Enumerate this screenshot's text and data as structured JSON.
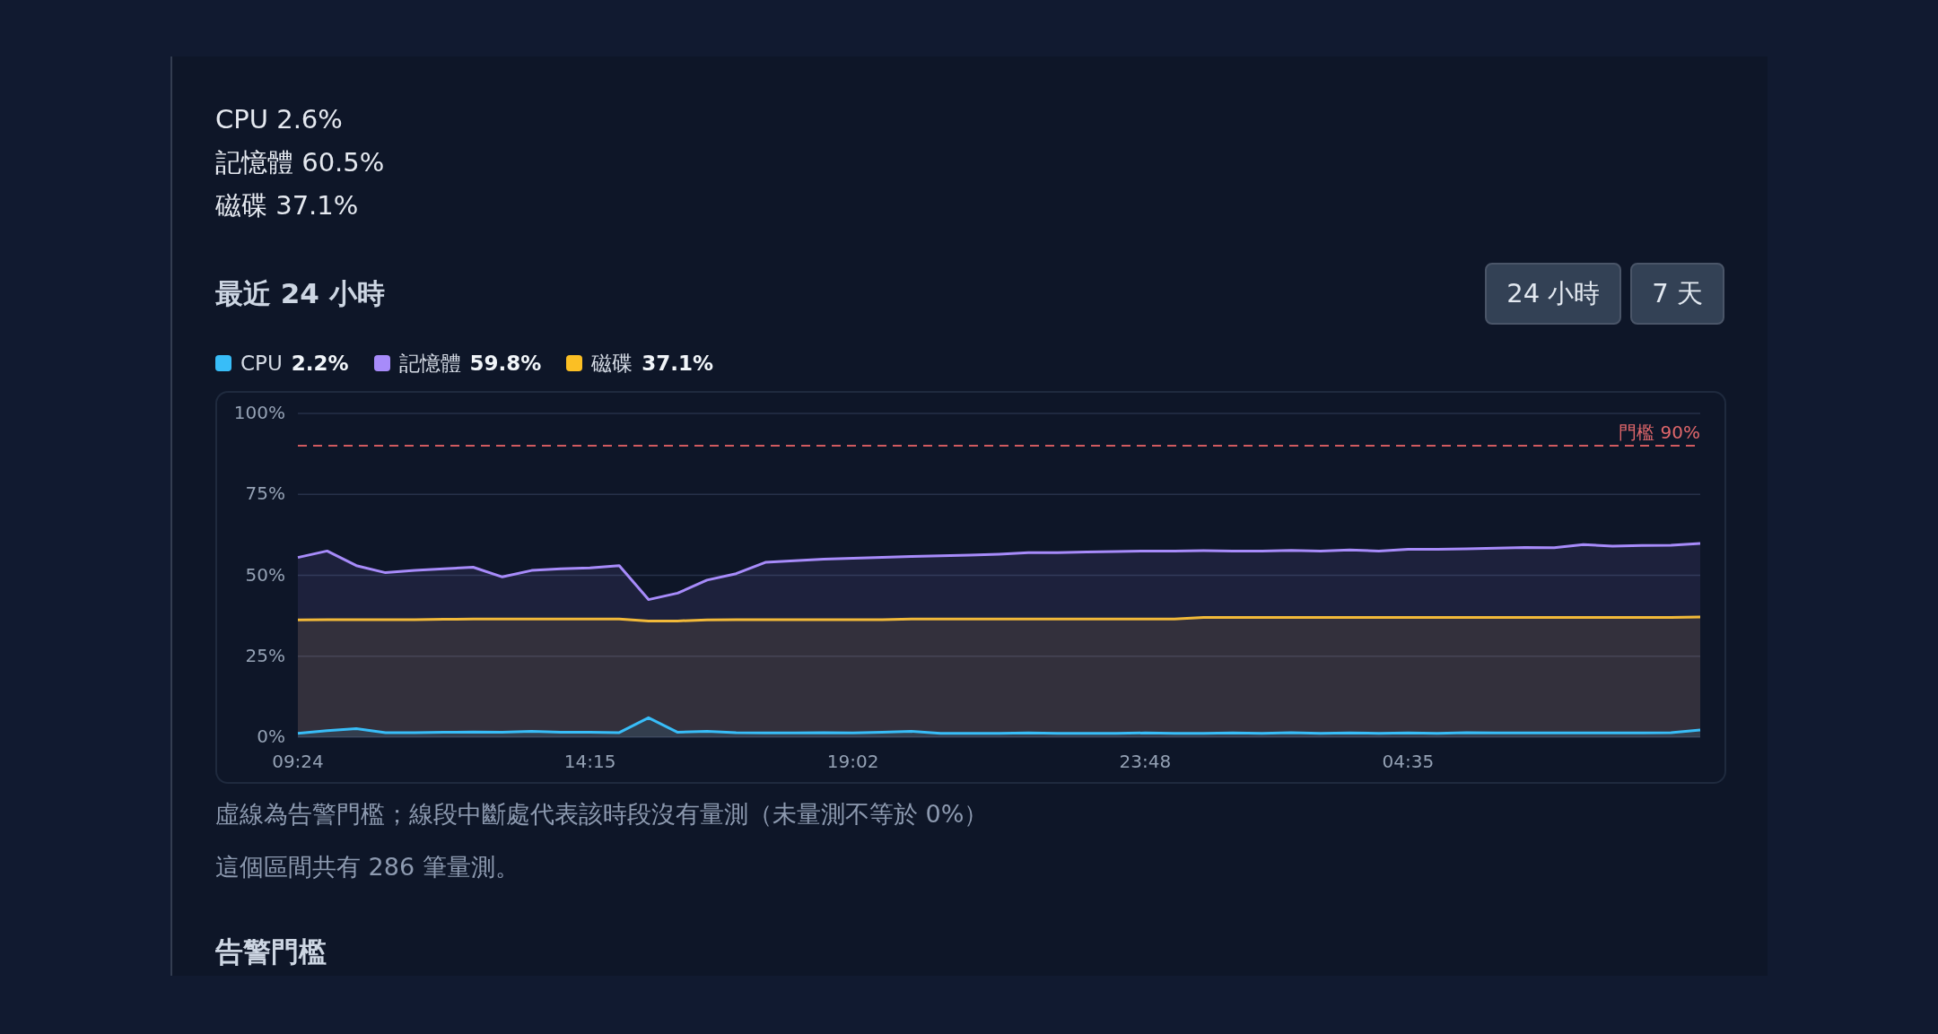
{
  "readouts": [
    "CPU 2.6%",
    "記憶體 60.5%",
    "磁碟 37.1%"
  ],
  "history": {
    "title": "最近 24 小時",
    "range_buttons": [
      "24 小時",
      "7 天"
    ],
    "legend": [
      {
        "name": "CPU",
        "value": "2.2%",
        "color": "#38bdf8"
      },
      {
        "name": "記憶體",
        "value": "59.8%",
        "color": "#a78bfa"
      },
      {
        "name": "磁碟",
        "value": "37.1%",
        "color": "#fbbf24"
      }
    ],
    "chart_data": {
      "type": "area",
      "stacked": false,
      "categories": [
        "09:24",
        null,
        null,
        null,
        null,
        null,
        null,
        null,
        null,
        null,
        "14:15",
        null,
        null,
        null,
        null,
        null,
        null,
        null,
        null,
        "19:02",
        null,
        null,
        null,
        null,
        null,
        null,
        null,
        null,
        null,
        "23:48",
        null,
        null,
        null,
        null,
        null,
        null,
        null,
        null,
        "04:35",
        null,
        null,
        null,
        null,
        null,
        null,
        null,
        null,
        null,
        null
      ],
      "series": [
        {
          "color": "#fbbf24",
          "values": [
            36.2,
            36.3,
            36.3,
            36.3,
            36.3,
            36.4,
            36.5,
            36.5,
            36.5,
            36.5,
            36.5,
            36.5,
            35.9,
            35.9,
            36.2,
            36.3,
            36.3,
            36.3,
            36.3,
            36.3,
            36.3,
            36.5,
            36.5,
            36.5,
            36.5,
            36.5,
            36.5,
            36.5,
            36.5,
            36.5,
            36.5,
            37,
            37,
            37,
            37,
            37,
            37,
            37,
            37,
            37,
            37,
            37,
            37,
            37,
            37,
            37,
            37,
            37,
            37.1
          ]
        },
        {
          "color": "#a78bfa",
          "values": [
            55.5,
            57.5,
            53,
            50.8,
            51.5,
            52,
            52.5,
            49.5,
            51.5,
            52,
            52.3,
            53,
            42.5,
            44.5,
            48.5,
            50.5,
            54,
            54.5,
            55,
            55.3,
            55.5,
            55.8,
            56,
            56.2,
            56.5,
            57,
            57,
            57.2,
            57.3,
            57.5,
            57.5,
            57.6,
            57.5,
            57.5,
            57.7,
            57.5,
            57.8,
            57.5,
            58,
            58,
            58.2,
            58.4,
            58.6,
            58.5,
            59.5,
            59,
            59.2,
            59.3,
            59.8
          ]
        },
        {
          "color": "#38bdf8",
          "values": [
            1.2,
            2,
            2.6,
            1.4,
            1.4,
            1.5,
            1.6,
            1.5,
            1.8,
            1.5,
            1.5,
            1.4,
            6,
            1.5,
            1.8,
            1.4,
            1.3,
            1.3,
            1.4,
            1.3,
            1.5,
            1.8,
            1.2,
            1.2,
            1.2,
            1.3,
            1.2,
            1.2,
            1.2,
            1.3,
            1.2,
            1.2,
            1.3,
            1.2,
            1.4,
            1.2,
            1.3,
            1.2,
            1.3,
            1.2,
            1.4,
            1.3,
            1.3,
            1.3,
            1.3,
            1.3,
            1.3,
            1.4,
            2.2
          ]
        }
      ],
      "ylim": [
        0,
        100
      ],
      "yticks": [
        {
          "value": 0,
          "label": "0%"
        },
        {
          "value": 25,
          "label": "25%"
        },
        {
          "value": 50,
          "label": "50%"
        },
        {
          "value": 75,
          "label": "75%"
        },
        {
          "value": 100,
          "label": "100%"
        }
      ],
      "grid": true,
      "ref_lines": [
        {
          "axis": "y",
          "value": 90,
          "label": "門檻 90%"
        }
      ]
    },
    "note": "虛線為告警門檻；線段中斷處代表該時段沒有量測（未量測不等於 0%）",
    "count": "這個區間共有 286 筆量測。"
  },
  "alerts": {
    "title": "告警門檻"
  }
}
